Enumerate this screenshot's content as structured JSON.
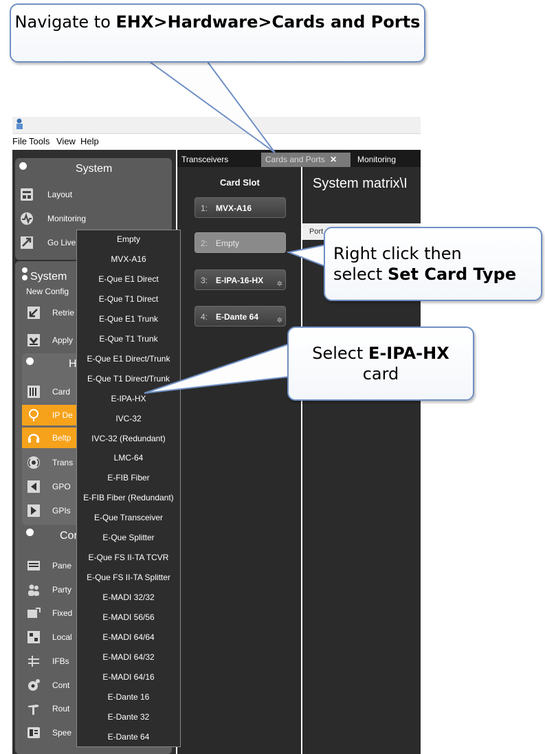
{
  "callouts": {
    "navigate": {
      "prefix": "Navigate to ",
      "bold": "EHX>Hardware>Cards and Ports"
    },
    "right_click": {
      "line1": "Right click then",
      "line2_prefix": "select ",
      "line2_bold": "Set Card Type"
    },
    "select_card": {
      "prefix": "Select ",
      "bold": "E-IPA-HX",
      "suffix": "card"
    }
  },
  "menubar": {
    "items": [
      "File",
      "Tools",
      "View",
      "Help"
    ]
  },
  "sidebar": {
    "system_header": "System",
    "system_items": [
      {
        "label": "Layout",
        "icon": "layout-icon"
      },
      {
        "label": "Monitoring",
        "icon": "monitoring-icon"
      },
      {
        "label": "Go Live",
        "icon": "go-live-icon"
      }
    ],
    "system2_header": "System",
    "new_config": "New Config",
    "system2_items": [
      {
        "label": "Retrie",
        "icon": "retrieve-icon"
      },
      {
        "label": "Apply",
        "icon": "apply-icon"
      }
    ],
    "hardware_header": "H",
    "hardware_items": [
      {
        "label": "Card",
        "icon": "cards-icon",
        "orange": false
      },
      {
        "label": "IP De",
        "icon": "ip-devices-icon",
        "orange": true
      },
      {
        "label": "Beltp",
        "icon": "beltpack-icon",
        "orange": true
      },
      {
        "label": "Trans",
        "icon": "transceiver-icon",
        "orange": false
      },
      {
        "label": "GPO",
        "icon": "gpo-icon",
        "orange": false
      },
      {
        "label": "GPIs",
        "icon": "gpi-icon",
        "orange": false
      }
    ],
    "config_header": "Cor",
    "config_items": [
      {
        "label": "Pane",
        "icon": "panels-icon"
      },
      {
        "label": "Party",
        "icon": "party-icon"
      },
      {
        "label": "Fixed",
        "icon": "fixed-groups-icon"
      },
      {
        "label": "Local",
        "icon": "local-icon"
      },
      {
        "label": "IFBs",
        "icon": "ifb-icon"
      },
      {
        "label": "Cont",
        "icon": "control-icon"
      },
      {
        "label": "Rout",
        "icon": "routes-icon"
      },
      {
        "label": "Spee",
        "icon": "speed-dial-icon"
      }
    ]
  },
  "tabs": [
    {
      "label": "Transceivers",
      "active": false
    },
    {
      "label": "Cards and Ports",
      "active": true,
      "close": "✕"
    },
    {
      "label": "Monitoring",
      "active": false
    }
  ],
  "card_slot": {
    "header": "Card Slot",
    "slots": [
      {
        "num": "1:",
        "name": "MVX-A16"
      },
      {
        "num": "2:",
        "name": "Empty"
      },
      {
        "num": "3:",
        "name": "E-IPA-16-HX"
      },
      {
        "num": "4:",
        "name": "E-Dante 64"
      }
    ]
  },
  "main": {
    "title": "System matrix\\I",
    "port_label": "Port"
  },
  "context_menu": {
    "items": [
      "Empty",
      "MVX-A16",
      "E-Que E1 Direct",
      "E-Que T1 Direct",
      "E-Que E1 Trunk",
      "E-Que T1 Trunk",
      "E-Que E1 Direct/Trunk",
      "E-Que T1 Direct/Trunk",
      "E-IPA-HX",
      "IVC-32",
      "IVC-32 (Redundant)",
      "LMC-64",
      "E-FIB Fiber",
      "E-FIB Fiber (Redundant)",
      "E-Que Transceiver",
      "E-Que Splitter",
      "E-Que FS II-TA TCVR",
      "E-Que FS II-TA Splitter",
      "E-MADI 32/32",
      "E-MADI 56/56",
      "E-MADI 64/64",
      "E-MADI 64/32",
      "E-MADI 64/16",
      "E-Dante 16",
      "E-Dante 32",
      "E-Dante 64"
    ]
  },
  "colors": {
    "accent_orange": "#f6a21b",
    "callout_border": "#6f8fc4",
    "panel_dark": "#2f2f2f"
  }
}
